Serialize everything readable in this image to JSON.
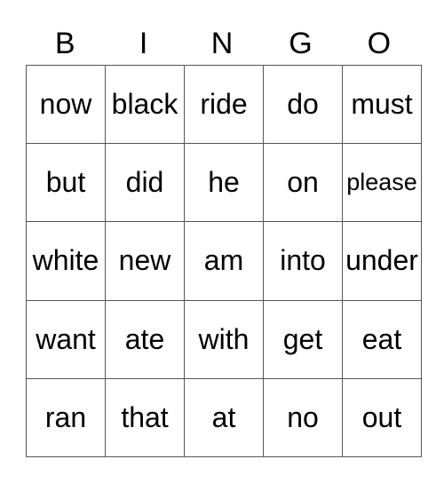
{
  "header": [
    "B",
    "I",
    "N",
    "G",
    "O"
  ],
  "rows": [
    [
      "now",
      "black",
      "ride",
      "do",
      "must"
    ],
    [
      "but",
      "did",
      "he",
      "on",
      "please"
    ],
    [
      "white",
      "new",
      "am",
      "into",
      "under"
    ],
    [
      "want",
      "ate",
      "with",
      "get",
      "eat"
    ],
    [
      "ran",
      "that",
      "at",
      "no",
      "out"
    ]
  ]
}
